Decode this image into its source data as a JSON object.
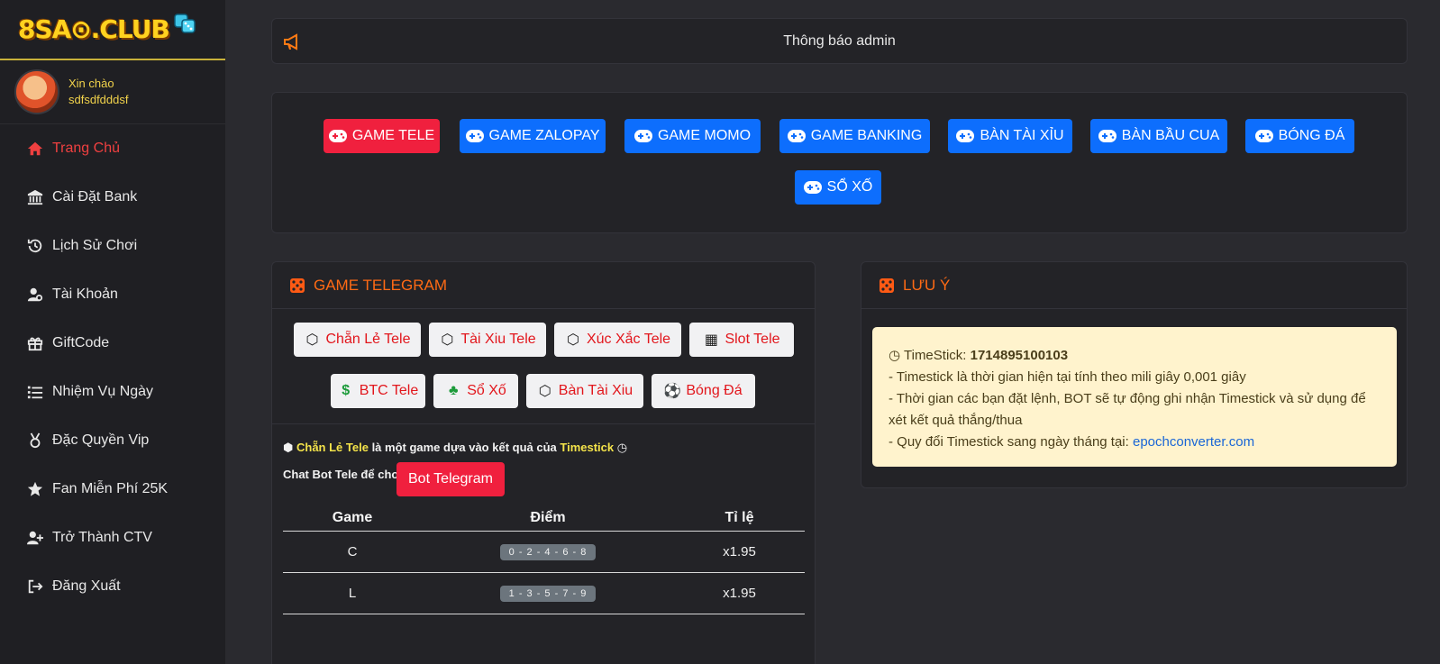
{
  "brand": {
    "logo_text": "8SA⊙.CLUB"
  },
  "user": {
    "greeting": "Xin chào",
    "username": "sdfsdfdddsf"
  },
  "sidebar": {
    "items": [
      {
        "label": "Trang Chủ",
        "icon": "home-icon",
        "active": true
      },
      {
        "label": "Cài Đặt Bank",
        "icon": "bank-icon"
      },
      {
        "label": "Lịch Sử Chơi",
        "icon": "history-icon"
      },
      {
        "label": "Tài Khoản",
        "icon": "user-gear-icon"
      },
      {
        "label": "GiftCode",
        "icon": "gift-icon"
      },
      {
        "label": "Nhiệm Vụ Ngày",
        "icon": "list-icon"
      },
      {
        "label": "Đặc Quyền Vip",
        "icon": "medal-icon"
      },
      {
        "label": "Fan Miễn Phí 25K",
        "icon": "star-icon"
      },
      {
        "label": "Trở Thành CTV",
        "icon": "user-plus-icon"
      },
      {
        "label": "Đăng Xuất",
        "icon": "logout-icon"
      }
    ]
  },
  "notice": {
    "title": "Thông báo admin",
    "icon": "megaphone-icon"
  },
  "game_buttons": [
    {
      "label": "GAME TELE",
      "color": "#f0203e"
    },
    {
      "label": "GAME ZALOPAY",
      "color": "#0d6efd"
    },
    {
      "label": "GAME MOMO",
      "color": "#0d6efd"
    },
    {
      "label": "GAME BANKING",
      "color": "#0d6efd"
    },
    {
      "label": "BÀN TÀI XỈU",
      "color": "#0d6efd"
    },
    {
      "label": "BÀN BẦU CUA",
      "color": "#0d6efd"
    },
    {
      "label": "BÓNG ĐÁ",
      "color": "#0d6efd"
    },
    {
      "label": "SỔ XỐ",
      "color": "#0d6efd"
    }
  ],
  "telegram": {
    "heading": "GAME TELEGRAM",
    "chips": [
      {
        "label": "Chẵn Lẻ Tele",
        "icon": "dice-icon"
      },
      {
        "label": "Tài Xiu Tele",
        "icon": "dice-icon"
      },
      {
        "label": "Xúc Xắc Tele",
        "icon": "dice-icon"
      },
      {
        "label": "Slot Tele",
        "icon": "slot-icon"
      },
      {
        "label": "BTC Tele",
        "icon": "dollar-icon"
      },
      {
        "label": "Sổ Xố",
        "icon": "clover-icon"
      },
      {
        "label": "Bàn Tài Xiu",
        "icon": "dice-icon"
      },
      {
        "label": "Bóng Đá",
        "icon": "soccer-icon"
      }
    ],
    "desc_game": "Chẵn Lẻ Tele",
    "desc_middle": "là một game dựa vào kết quả của",
    "desc_source": "Timestick",
    "chat_text": "Chat Bot Tele để chơi",
    "bot_button": "Bot Telegram",
    "table": {
      "headers": [
        "Game",
        "Điểm",
        "Tỉ lệ"
      ],
      "rows": [
        {
          "game": "C",
          "points": "0 - 2 - 4 - 6 - 8",
          "rate": "x1.95"
        },
        {
          "game": "L",
          "points": "1 - 3 - 5 - 7 - 9",
          "rate": "x1.95"
        }
      ]
    }
  },
  "luu_y": {
    "heading": "LƯU Ý",
    "timestick_label": "TimeStick:",
    "timestick_value": "1714895100103",
    "line1": "- Timestick là thời gian hiện tại tính theo mili giây 0,001 giây",
    "line2": "- Thời gian các bạn đặt lệnh, BOT sẽ tự động ghi nhận Timestick và sử dụng để xét kết quả thắng/thua",
    "line3": "- Quy đổi Timestick sang ngày tháng tại:",
    "link": "epochconverter.com"
  }
}
